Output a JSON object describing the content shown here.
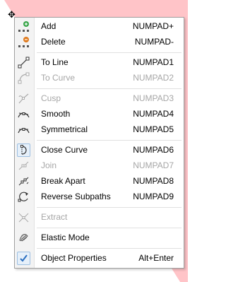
{
  "colors": {
    "background_pink": "#ffc4c8",
    "menu_bg": "#ffffff",
    "gutter_bg": "#f3f3f3",
    "disabled_text": "#a6a6a6",
    "checked_icon_blue": "#2a6fc0"
  },
  "cursor": {
    "icon": "pick-tool-cursor"
  },
  "menu": {
    "items": [
      {
        "label": "Add",
        "shortcut": "NUMPAD+",
        "icon": "add-node-icon",
        "enabled": true
      },
      {
        "label": "Delete",
        "shortcut": "NUMPAD-",
        "icon": "delete-node-icon",
        "enabled": true
      },
      {
        "label": "To Line",
        "shortcut": "NUMPAD1",
        "icon": "to-line-icon",
        "enabled": true
      },
      {
        "label": "To Curve",
        "shortcut": "NUMPAD2",
        "icon": "to-curve-icon",
        "enabled": false
      },
      {
        "label": "Cusp",
        "shortcut": "NUMPAD3",
        "icon": "cusp-icon",
        "enabled": false
      },
      {
        "label": "Smooth",
        "shortcut": "NUMPAD4",
        "icon": "smooth-icon",
        "enabled": true
      },
      {
        "label": "Symmetrical",
        "shortcut": "NUMPAD5",
        "icon": "symmetrical-icon",
        "enabled": true
      },
      {
        "label": "Close Curve",
        "shortcut": "NUMPAD6",
        "icon": "close-curve-icon",
        "enabled": true
      },
      {
        "label": "Join",
        "shortcut": "NUMPAD7",
        "icon": "join-icon",
        "enabled": false
      },
      {
        "label": "Break Apart",
        "shortcut": "NUMPAD8",
        "icon": "break-apart-icon",
        "enabled": true
      },
      {
        "label": "Reverse Subpaths",
        "shortcut": "NUMPAD9",
        "icon": "reverse-subpaths-icon",
        "enabled": true
      },
      {
        "label": "Extract",
        "shortcut": "",
        "icon": "extract-icon",
        "enabled": false
      },
      {
        "label": "Elastic Mode",
        "shortcut": "",
        "icon": "elastic-mode-icon",
        "enabled": true
      },
      {
        "label": "Object Properties",
        "shortcut": "Alt+Enter",
        "icon": "check-icon",
        "enabled": true,
        "checked": true
      }
    ]
  }
}
